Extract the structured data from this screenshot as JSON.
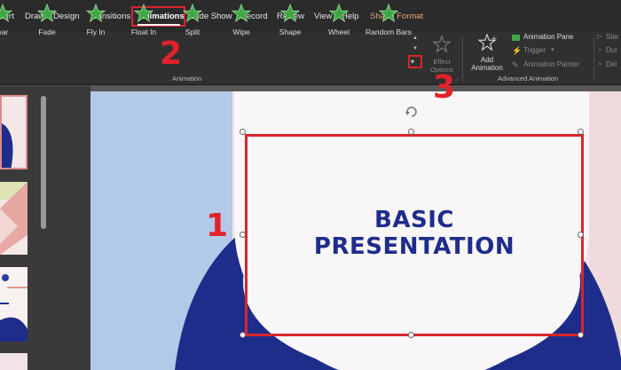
{
  "tabs": [
    "sert",
    "Draw",
    "Design",
    "Transitions",
    "Animations",
    "Slide Show",
    "Record",
    "Review",
    "View",
    "Help",
    "Shape Format"
  ],
  "active_tab": "Animations",
  "animations": [
    "ear",
    "Fade",
    "Fly In",
    "Float In",
    "Split",
    "Wipe",
    "Shape",
    "Wheel",
    "Random Bars"
  ],
  "effect_options": {
    "line1": "Effect",
    "line2": "Options"
  },
  "add_animation": {
    "line1": "Add",
    "line2": "Animation"
  },
  "advanced": {
    "pane": "Animation Pane",
    "trigger": "Trigger",
    "painter": "Animation Painter"
  },
  "timing": [
    "Star",
    "Dur",
    "Del"
  ],
  "group_labels": {
    "animation": "Animation",
    "advanced": "Advanced Animation"
  },
  "slide": {
    "title_line1": "BASIC",
    "title_line2": "PRESENTATION"
  },
  "callouts": {
    "one": "1",
    "two": "2",
    "three": "3"
  },
  "colors": {
    "accent_red": "#d8262b",
    "navy": "#1f2d8a",
    "star_green": "#3fa845"
  }
}
